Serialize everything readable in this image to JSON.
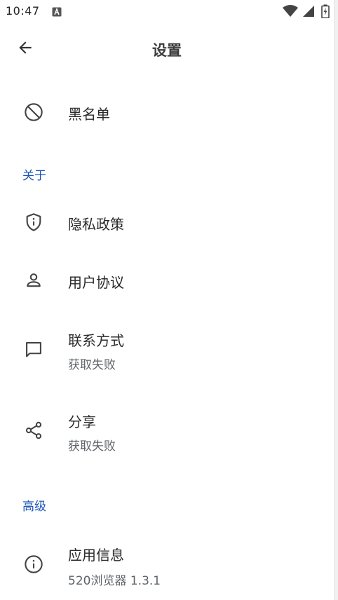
{
  "status_bar": {
    "time": "10:47",
    "icons": [
      "notification-a-icon",
      "wifi-icon",
      "signal-icon",
      "battery-charging-icon"
    ]
  },
  "app_bar": {
    "back_icon": "arrow-left-icon",
    "title": "设置"
  },
  "items_top": [
    {
      "icon": "block-icon",
      "title": "黑名单"
    }
  ],
  "sections": {
    "about": {
      "header": "关于",
      "items": [
        {
          "icon": "shield-info-icon",
          "title": "隐私政策"
        },
        {
          "icon": "person-icon",
          "title": "用户协议"
        },
        {
          "icon": "chat-bubble-icon",
          "title": "联系方式",
          "subtitle": "获取失败"
        },
        {
          "icon": "share-icon",
          "title": "分享",
          "subtitle": "获取失败"
        }
      ]
    },
    "advanced": {
      "header": "高级",
      "items": [
        {
          "icon": "info-icon",
          "title": "应用信息",
          "subtitle": "520浏览器 1.3.1"
        }
      ]
    }
  },
  "colors": {
    "accent": "#1a56b8",
    "text_primary": "#2a2a2a",
    "text_secondary": "#5f6368",
    "background": "#ffffff"
  }
}
